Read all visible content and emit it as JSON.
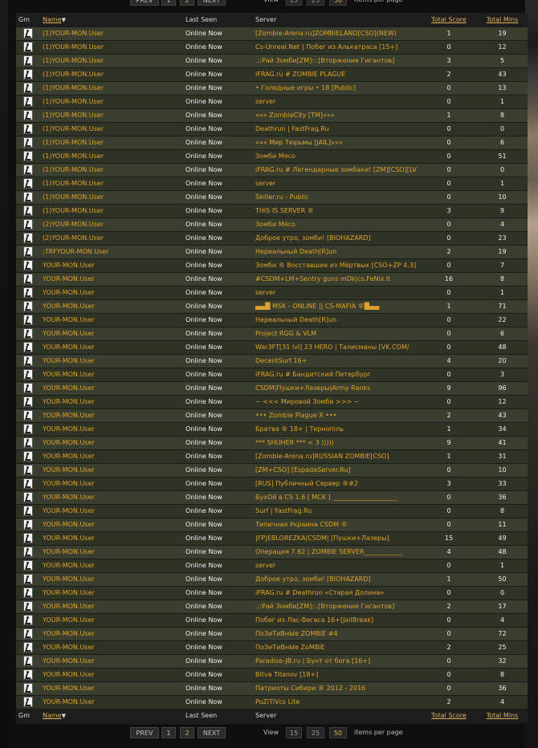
{
  "pager": {
    "prev": "PREV",
    "next": "NEXT",
    "pages": [
      "1",
      "2"
    ],
    "current_page": "2",
    "view_label": "View",
    "per_page_options": [
      "15",
      "25",
      "50"
    ],
    "per_page_selected": "50",
    "per_page_suffix": "items per page"
  },
  "table": {
    "headers": {
      "gm": "Gm",
      "name": "Name",
      "last_seen": "Last Seen",
      "server": "Server",
      "total_score": "Total Score",
      "total_mins": "Total Mins"
    },
    "sort_arrow": "▼",
    "icon": "counter-strike-game-icon",
    "rows": [
      {
        "name": "(1)YOUR-MON.User",
        "seen": "Online Now",
        "server": "[Zombie-Arena.ru]ZOMBIELAND[CSO](NEW)",
        "score": "1",
        "mins": "19"
      },
      {
        "name": "(1)YOUR-MON.User",
        "seen": "Online Now",
        "server": "Cs-Unreal.Net | Побег из Алькатраса [15+]",
        "score": "0",
        "mins": "12"
      },
      {
        "name": "(1)YOUR-MON.User",
        "seen": "Online Now",
        "server": ".::Рай Зомби[ZM]::.[Вторжение Гигантов]",
        "score": "3",
        "mins": "5"
      },
      {
        "name": "(1)YOUR-MON.User",
        "seen": "Online Now",
        "server": "iFRAG.ru # ZOMBIE PLAGUE",
        "score": "2",
        "mins": "43"
      },
      {
        "name": "(1)YOUR-MON.User",
        "seen": "Online Now",
        "server": "• Голодные игры • 18 [Public]",
        "score": "0",
        "mins": "13"
      },
      {
        "name": "(1)YOUR-MON.User",
        "seen": "Online Now",
        "server": "server",
        "score": "0",
        "mins": "1"
      },
      {
        "name": "(1)YOUR-MON.User",
        "seen": "Online Now",
        "server": "««« ZombieCity [TM]»»»",
        "score": "1",
        "mins": "8"
      },
      {
        "name": "(1)YOUR-MON.User",
        "seen": "Online Now",
        "server": "Deathrun | FastFrag.Ru",
        "score": "0",
        "mins": "0"
      },
      {
        "name": "(1)YOUR-MON.User",
        "seen": "Online Now",
        "server": "««« Мир Тюрьмы [JAIL]»»»",
        "score": "0",
        "mins": "6"
      },
      {
        "name": "(1)YOUR-MON.User",
        "seen": "Online Now",
        "server": "Зомби Мясо",
        "score": "0",
        "mins": "51"
      },
      {
        "name": "(1)YOUR-MON.User",
        "seen": "Online Now",
        "server": "iFRAG.ru # Легендарные зомбаки! [ZM][CSO][LV",
        "score": "0",
        "mins": "0"
      },
      {
        "name": "(1)YOUR-MON.User",
        "seen": "Online Now",
        "server": "server",
        "score": "0",
        "mins": "1"
      },
      {
        "name": "(1)YOUR-MON.User",
        "seen": "Online Now",
        "server": "Skiller.ru - Public",
        "score": "0",
        "mins": "10"
      },
      {
        "name": "(1)YOUR-MON.User",
        "seen": "Online Now",
        "server": "THIS IS SERVER ®",
        "score": "3",
        "mins": "9"
      },
      {
        "name": "(2)YOUR-MON.User",
        "seen": "Online Now",
        "server": "Зомби Мясо",
        "score": "0",
        "mins": "4"
      },
      {
        "name": "(2)YOUR-MON.User",
        "seen": "Online Now",
        "server": "Доброе утро, зомби! [BIOHAZARD]",
        "score": "0",
        "mins": "23"
      },
      {
        "name": ";TRFYOUR-MON.User",
        "seen": "Online Now",
        "server": "Нереальный Death[R]un",
        "score": "2",
        "mins": "19"
      },
      {
        "name": "YOUR-MON.User",
        "seen": "Online Now",
        "server": "Зомби ® Восставшие из Мёртвых [CSO+ZP 4.3]",
        "score": "0",
        "mins": "7"
      },
      {
        "name": "YOUR-MON.User",
        "seen": "Online Now",
        "server": "#CSDM+LM+Sentry guns mDk|cs.FeNix.lt",
        "score": "16",
        "mins": "8"
      },
      {
        "name": "YOUR-MON.User",
        "seen": "Online Now",
        "server": "server",
        "score": "0",
        "mins": "1"
      },
      {
        "name": "YOUR-MON.User",
        "seen": "Online Now",
        "server": "▄▄█ MSK - ONLINE || CS-MAFIA ®█▄▄",
        "score": "1",
        "mins": "71"
      },
      {
        "name": "YOUR-MON.User",
        "seen": "Online Now",
        "server": "Нереальный Death[R]un",
        "score": "0",
        "mins": "22"
      },
      {
        "name": "YOUR-MON.User",
        "seen": "Online Now",
        "server": "Project RGG & VLM",
        "score": "0",
        "mins": "6"
      },
      {
        "name": "YOUR-MON.User",
        "seen": "Online Now",
        "server": "War3FT[31 lvl] 23 HERO | Талисманы [VK.COM/",
        "score": "0",
        "mins": "48"
      },
      {
        "name": "YOUR-MON.User",
        "seen": "Online Now",
        "server": "DecentSurf 16+",
        "score": "4",
        "mins": "20"
      },
      {
        "name": "YOUR-MON.User",
        "seen": "Online Now",
        "server": "iFRAG.ru # Бандитский Петербург",
        "score": "0",
        "mins": "3"
      },
      {
        "name": "YOUR-MON.User",
        "seen": "Online Now",
        "server": "CSDM|Пушки+Лазеры|Army Ranks",
        "score": "9",
        "mins": "96"
      },
      {
        "name": "YOUR-MON.User",
        "seen": "Online Now",
        "server": "~ <<< Мировой Зомби >>> ~",
        "score": "0",
        "mins": "12"
      },
      {
        "name": "YOUR-MON.User",
        "seen": "Online Now",
        "server": "••• Zombie Plague X •••",
        "score": "2",
        "mins": "43"
      },
      {
        "name": "YOUR-MON.User",
        "seen": "Online Now",
        "server": "Братва ® 18+ | Тернопіль",
        "score": "1",
        "mins": "34"
      },
      {
        "name": "YOUR-MON.User",
        "seen": "Online Now",
        "server": "*** SHUHER *** < 3 )))))",
        "score": "9",
        "mins": "41"
      },
      {
        "name": "YOUR-MON.User",
        "seen": "Online Now",
        "server": "[Zombie-Arena.ru]RUSSIAN ZOMBIE[CSO]",
        "score": "1",
        "mins": "31"
      },
      {
        "name": "YOUR-MON.User",
        "seen": "Online Now",
        "server": "[ZM+CSO] [EspadaServer.Ru]",
        "score": "0",
        "mins": "10"
      },
      {
        "name": "YOUR-MON.User",
        "seen": "Online Now",
        "server": "[RUS] Публичный Сервер ®#2",
        "score": "3",
        "mins": "33"
      },
      {
        "name": "YOUR-MON.User",
        "seen": "Online Now",
        "server": "БухОй в CS 1.6 [ MCK ] ____________________",
        "score": "0",
        "mins": "36"
      },
      {
        "name": "YOUR-MON.User",
        "seen": "Online Now",
        "server": "Surf | FastFrag.Ru",
        "score": "0",
        "mins": "8"
      },
      {
        "name": "YOUR-MON.User",
        "seen": "Online Now",
        "server": "Типичная Украина CSDM ®",
        "score": "0",
        "mins": "11"
      },
      {
        "name": "YOUR-MON.User",
        "seen": "Online Now",
        "server": "|FP|EBLOREZKA|CSDM| [Пушки+Лазеры]",
        "score": "15",
        "mins": "49"
      },
      {
        "name": "YOUR-MON.User",
        "seen": "Online Now",
        "server": "Операция 7.62 | ZOMBIE SERVER____________",
        "score": "4",
        "mins": "48"
      },
      {
        "name": "YOUR-MON.User",
        "seen": "Online Now",
        "server": "server",
        "score": "0",
        "mins": "1"
      },
      {
        "name": "YOUR-MON.User",
        "seen": "Online Now",
        "server": "Доброе утро, зомби! [BIOHAZARD]",
        "score": "1",
        "mins": "50"
      },
      {
        "name": "YOUR-MON.User",
        "seen": "Online Now",
        "server": "iFRAG.ru # Deathrun «Старая Долина»",
        "score": "0",
        "mins": "0"
      },
      {
        "name": "YOUR-MON.User",
        "seen": "Online Now",
        "server": ".::Рай Зомби[ZM]::.[Вторжение Гигантов]",
        "score": "2",
        "mins": "17"
      },
      {
        "name": "YOUR-MON.User",
        "seen": "Online Now",
        "server": "Побег из Лас-Вегаса 16+[JailBreak]",
        "score": "0",
        "mins": "4"
      },
      {
        "name": "YOUR-MON.User",
        "seen": "Online Now",
        "server": "ПоЗиТиВнЫе ZOMBIE #4",
        "score": "0",
        "mins": "72"
      },
      {
        "name": "YOUR-MON.User",
        "seen": "Online Now",
        "server": "ПоЗиТиВнЫе ZoMBiE",
        "score": "2",
        "mins": "25"
      },
      {
        "name": "YOUR-MON.User",
        "seen": "Online Now",
        "server": "Paradise-JB.ru | Бунт от бога [16+]",
        "score": "0",
        "mins": "32"
      },
      {
        "name": "YOUR-MON.User",
        "seen": "Online Now",
        "server": "Bitva Titanov [18+]",
        "score": "0",
        "mins": "8"
      },
      {
        "name": "YOUR-MON.User",
        "seen": "Online Now",
        "server": "Патриоты Сибири ® 2012 - 2016",
        "score": "0",
        "mins": "36"
      },
      {
        "name": "YOUR-MON.User",
        "seen": "Online Now",
        "server": "PoZiTiVcs Lite",
        "score": "2",
        "mins": "4"
      }
    ]
  },
  "colors": {
    "accent": "#e0a22a",
    "row_dark": "#2f3326",
    "row_light": "#3a3e2e",
    "header_bg": "#1e1e1e"
  }
}
